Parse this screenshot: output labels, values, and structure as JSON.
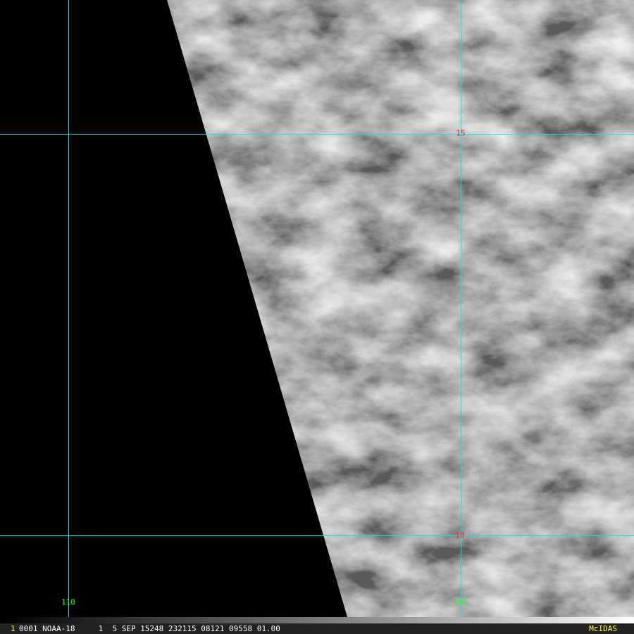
{
  "grid": {
    "latitude_labels": [
      "15",
      "10"
    ],
    "longitude_labels": [
      "110",
      "105"
    ]
  },
  "status_bar": {
    "frame_number": "1",
    "text": "0001 NOAA-18     1  5 SEP 15248 232115 08121 09558 01.00",
    "brand": "McIDAS"
  },
  "colors": {
    "grid": "#00e5ee",
    "latitude_label": "#ff2020",
    "longitude_label": "#20ff20",
    "status_highlight": "#ffff33"
  }
}
